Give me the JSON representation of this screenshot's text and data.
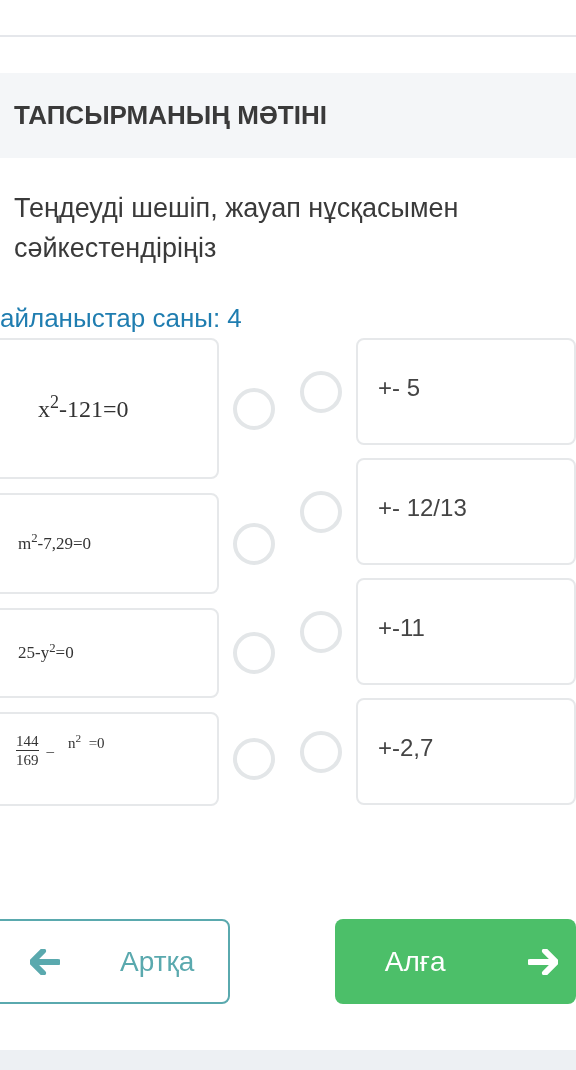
{
  "section_title": "ТАПСЫРМАНЫҢ МӘТІНІ",
  "question": "Теңдеуді шешіп, жауап нұсқасымен сәйкестендіріңіз",
  "connections_count": "айланыстар саны: 4",
  "left_items": [
    {
      "kind": "text",
      "text": "x$^{2}$-121=0",
      "selected": false
    },
    {
      "kind": "text",
      "text": "m$^{2}$-7,29=0",
      "selected": false
    },
    {
      "kind": "text",
      "text": "25-y$^{2}$=0",
      "selected": false
    },
    {
      "kind": "fraction",
      "numerator": "144",
      "denominator": "169",
      "operator": "–",
      "rest": "n$^{2}$  =0",
      "selected": false
    }
  ],
  "right_items": [
    {
      "text": "+- 5",
      "selected": false
    },
    {
      "text": "+- 12/13",
      "selected": false
    },
    {
      "text": "+-11",
      "selected": false
    },
    {
      "text": "+-2,7",
      "selected": false
    }
  ],
  "buttons": {
    "back": "Артқа",
    "next": "Алға"
  }
}
